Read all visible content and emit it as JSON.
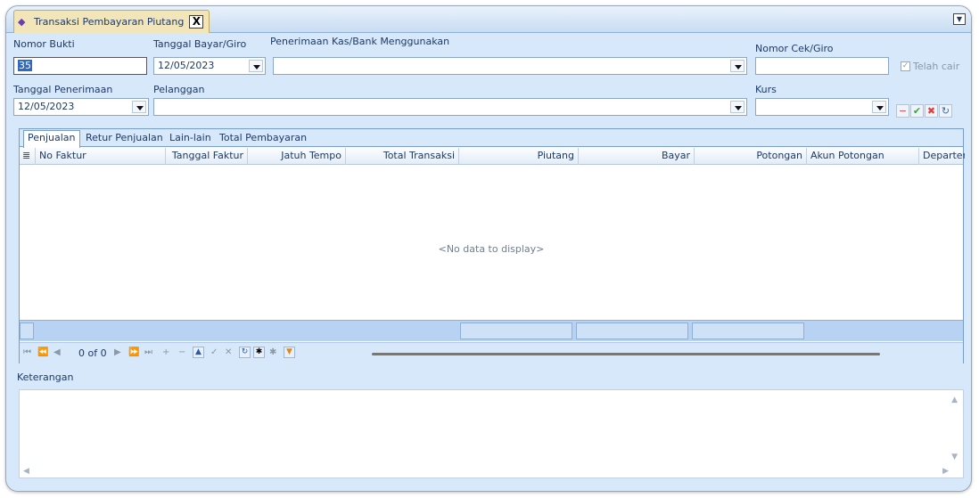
{
  "window": {
    "tab_title": "Transaksi Pembayaran Piutang",
    "close_glyph": "X"
  },
  "form": {
    "nomor_bukti": {
      "label": "Nomor Bukti",
      "value": "35"
    },
    "tanggal_bayar": {
      "label": "Tanggal Bayar/Giro",
      "value": "12/05/2023"
    },
    "penerimaan_kas": {
      "label": "Penerimaan Kas/Bank Menggunakan",
      "value": ""
    },
    "nomor_cek": {
      "label": "Nomor Cek/Giro",
      "value": ""
    },
    "telah_cair": {
      "label": "Telah cair",
      "checked": true
    },
    "tanggal_penerimaan": {
      "label": "Tanggal Penerimaan",
      "value": "12/05/2023"
    },
    "pelanggan": {
      "label": "Pelanggan",
      "value": ""
    },
    "kurs": {
      "label": "Kurs",
      "value": ""
    }
  },
  "grid": {
    "tabs": [
      "Penjualan",
      "Retur Penjualan",
      "Lain-lain",
      "Total Pembayaran"
    ],
    "columns": [
      "No Faktur",
      "Tanggal Faktur",
      "Jatuh Tempo",
      "Total Transaksi",
      "Piutang",
      "Bayar",
      "Potongan",
      "Akun Potongan",
      "Departer"
    ],
    "empty_text": "<No data to display>",
    "nav_text": "0 of 0"
  },
  "keterangan": {
    "label": "Keterangan",
    "value": ""
  },
  "colors": {
    "background": "#d6e8fa",
    "tab_active": "#f2e5ba",
    "accent": "#3168c0"
  }
}
